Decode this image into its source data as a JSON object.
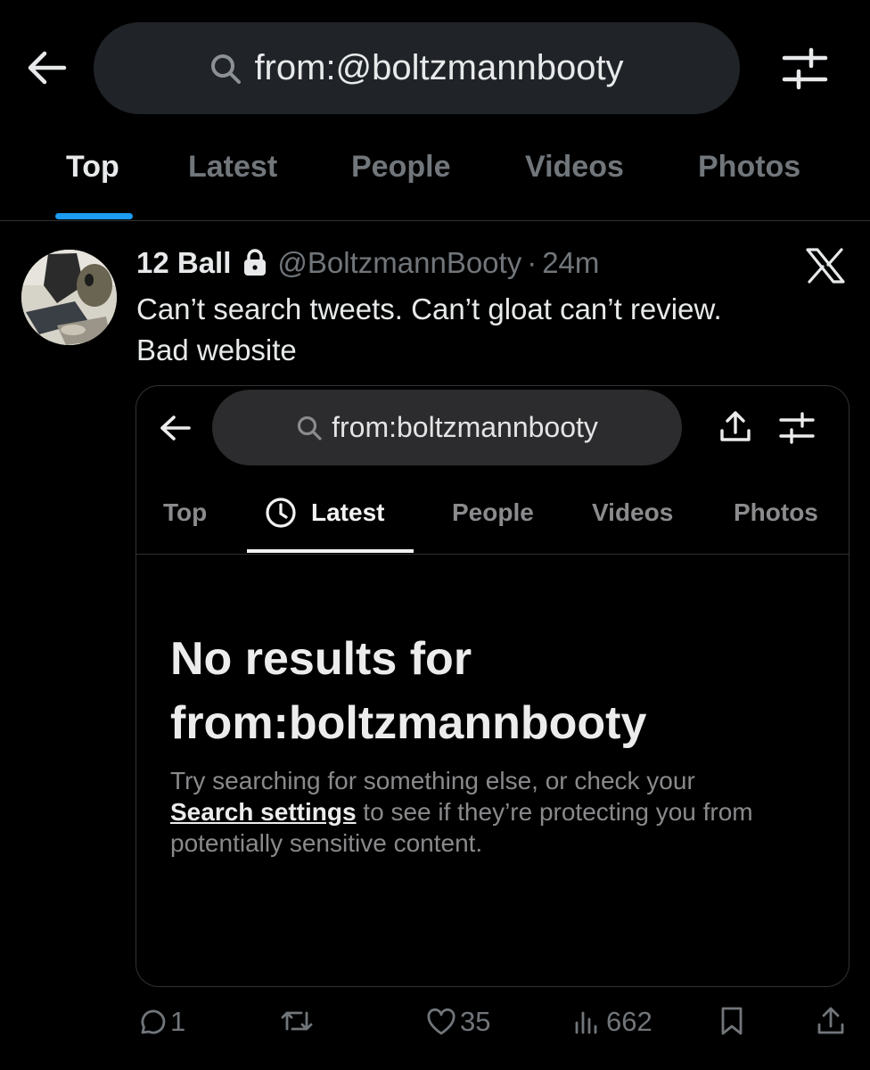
{
  "search": {
    "query": "from:@boltzmannbooty"
  },
  "tabs": [
    "Top",
    "Latest",
    "People",
    "Videos",
    "Photos"
  ],
  "active_tab": "Top",
  "tweet": {
    "name": "12 Ball",
    "handle": "@BoltzmannBooty",
    "separator": "·",
    "time": "24m",
    "text_line1": "Can’t search tweets. Can’t gloat can’t review.",
    "text_line2": "Bad website"
  },
  "embedded": {
    "search_query": "from:boltzmannbooty",
    "tabs": [
      "Top",
      "Latest",
      "People",
      "Videos",
      "Photos"
    ],
    "active_tab": "Latest",
    "no_results_line1": "No results for",
    "no_results_line2": "from:boltzmannbooty",
    "hint_part1": "Try searching for something else, or check your",
    "hint_link": "Search settings",
    "hint_part2": " to see if they’re protecting you from potentially sensitive content."
  },
  "actions": {
    "replies": "1",
    "retweets": "",
    "likes": "35",
    "views": "662"
  },
  "colors": {
    "accent": "#1d9bf0",
    "background": "#000000",
    "muted": "#71767b"
  }
}
